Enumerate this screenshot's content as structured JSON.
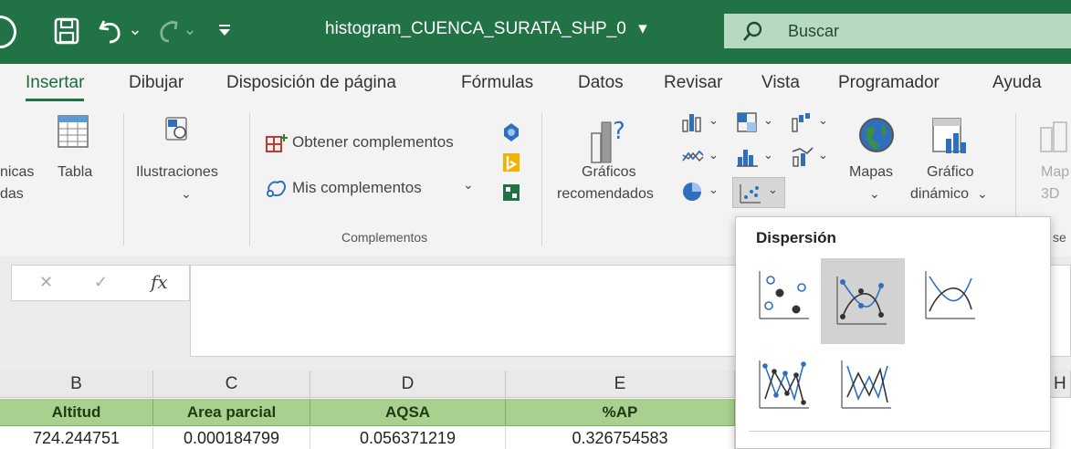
{
  "titlebar": {
    "title": "histogram_CUENCA_SURATA_SHP_0",
    "title_caret": "▾",
    "search_placeholder": "Buscar",
    "qat_undo_caret": "⌄",
    "qat_redo_caret": "⌄",
    "qat_customize": "▾"
  },
  "menu": {
    "tabs": [
      "Insertar",
      "Dibujar",
      "Disposición de página",
      "Fórmulas",
      "Datos",
      "Revisar",
      "Vista",
      "Programador",
      "Ayuda"
    ],
    "active_tab": "Insertar"
  },
  "ribbon": {
    "tables_partial_line1": "nicas",
    "tables_partial_line2": "das",
    "table_label": "Tabla",
    "illustrations_label": "Ilustraciones",
    "illustrations_caret": "⌄",
    "get_addins_label": "Obtener complementos",
    "my_addins_label": "Mis complementos",
    "my_addins_caret": "⌄",
    "addins_group_label": "Complementos",
    "recommended_charts_line1": "Gráficos",
    "recommended_charts_line2": "recomendados",
    "maps_label": "Mapas",
    "maps_caret": "⌄",
    "pivot_chart_line1": "Gráfico",
    "pivot_chart_line2": "dinámico",
    "pivot_chart_caret": "⌄",
    "map3d_partial_line1": "Map",
    "map3d_partial_line2": "3D",
    "group_partial_right": "se",
    "chart_caret": "⌄"
  },
  "formula_bar": {
    "cancel_symbol": "✕",
    "enter_symbol": "✓",
    "fx_label": "fx",
    "content": ""
  },
  "sheet": {
    "column_headers": [
      "B",
      "C",
      "D",
      "E",
      "H"
    ],
    "header_row": [
      "Altitud",
      "Area parcial",
      "AQSA",
      "%AP"
    ],
    "first_row": [
      "724.244751",
      "0.000184799",
      "0.056371219",
      "0.326754583"
    ]
  },
  "dropdown": {
    "title": "Dispersión",
    "options": [
      "scatter-markers",
      "scatter-smooth-lines-markers",
      "scatter-smooth-lines",
      "scatter-straight-lines-markers",
      "scatter-straight-lines"
    ],
    "selected_option": "scatter-smooth-lines-markers"
  },
  "colors": {
    "excel_green": "#217346",
    "header_fill": "#a9d08e",
    "selection_gray": "#d2d2d2",
    "chart_blue": "#2f6fbe"
  }
}
